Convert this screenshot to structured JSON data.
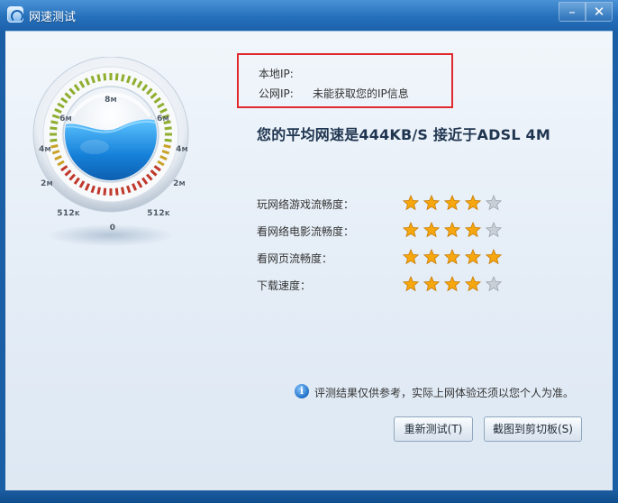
{
  "window": {
    "title": "网速测试",
    "minimize_label": "–",
    "close_label": "✕"
  },
  "gauge": {
    "labels": [
      {
        "key": "8M-top",
        "main": "8",
        "unit": "M"
      },
      {
        "key": "6M-left",
        "main": "6",
        "unit": "M"
      },
      {
        "key": "6M-right",
        "main": "6",
        "unit": "M"
      },
      {
        "key": "4M-left",
        "main": "4",
        "unit": "M"
      },
      {
        "key": "4M-right",
        "main": "4",
        "unit": "M"
      },
      {
        "key": "2M-left",
        "main": "2",
        "unit": "M"
      },
      {
        "key": "2M-right",
        "main": "2",
        "unit": "M"
      },
      {
        "key": "512K-left",
        "main": "512",
        "unit": "K"
      },
      {
        "key": "512K-right",
        "main": "512",
        "unit": "K"
      },
      {
        "key": "0",
        "main": "0",
        "unit": ""
      }
    ]
  },
  "ip": {
    "local_label": "本地IP:",
    "local_value": "",
    "public_label": "公网IP:",
    "public_value": "未能获取您的IP信息"
  },
  "headline": "您的平均网速是444KB/S 接近于ADSL 4M",
  "ratings": [
    {
      "label": "玩网络游戏流畅度：",
      "stars": 4,
      "max": 5
    },
    {
      "label": "看网络电影流畅度：",
      "stars": 4,
      "max": 5
    },
    {
      "label": "看网页流畅度：",
      "stars": 5,
      "max": 5
    },
    {
      "label": "下载速度：",
      "stars": 4,
      "max": 5
    }
  ],
  "note": {
    "icon": "info-icon",
    "text": "评测结果仅供参考，实际上网体验还须以您个人为准。"
  },
  "buttons": {
    "retest": "重新测试(T)",
    "copy": "截图到剪切板(S)"
  },
  "colors": {
    "highlight_box": "#e0292f",
    "star_filled": "#f6a70f",
    "star_empty": "#c9cfd6"
  }
}
